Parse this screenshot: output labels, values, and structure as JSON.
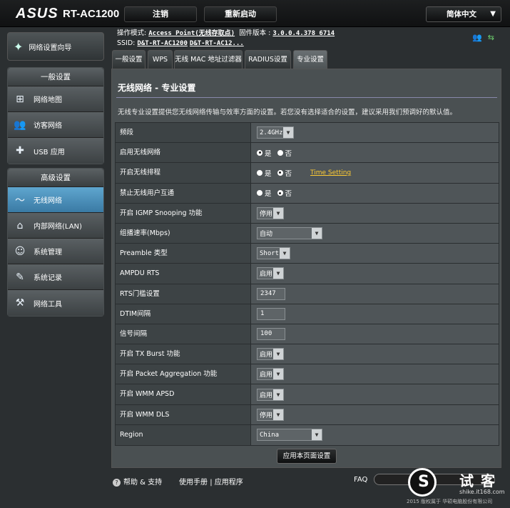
{
  "header": {
    "brand": "ASUS",
    "model": "RT-AC1200",
    "logout_label": "注销",
    "reboot_label": "重新启动",
    "language": "简体中文"
  },
  "info": {
    "mode_label": "操作模式:",
    "mode_value": "Access Point(无线存取点)",
    "firmware_label": "固件版本 :",
    "firmware_value": "3.0.0.4.378_6714",
    "ssid_label": "SSID:",
    "ssid_1": "D&T-RT-AC1200",
    "ssid_2": "D&T-RT-AC12..."
  },
  "sidebar": {
    "wizard_label": "网络设置向导",
    "general_header": "一般设置",
    "general_items": [
      {
        "label": "网络地图",
        "icon": "network-map-icon"
      },
      {
        "label": "访客网络",
        "icon": "guest-network-icon"
      },
      {
        "label": "USB 应用",
        "icon": "usb-app-icon"
      }
    ],
    "advanced_header": "高级设置",
    "advanced_items": [
      {
        "label": "无线网络",
        "icon": "wireless-icon",
        "active": true
      },
      {
        "label": "内部网络(LAN)",
        "icon": "lan-icon"
      },
      {
        "label": "系统管理",
        "icon": "admin-icon"
      },
      {
        "label": "系统记录",
        "icon": "log-icon"
      },
      {
        "label": "网络工具",
        "icon": "tools-icon"
      }
    ]
  },
  "tabs": [
    "一般设置",
    "WPS",
    "无线 MAC 地址过滤器",
    "RADIUS设置",
    "专业设置"
  ],
  "main": {
    "title": "无线网络 - 专业设置",
    "description": "无线专业设置提供您无线网络传输与效率方面的设置。若您没有选择适合的设置，建议采用我们预调好的默认值。",
    "radio_yes": "是",
    "radio_no": "否",
    "time_setting_link": "Time Setting",
    "apply_label": "应用本页面设置",
    "rows": {
      "band": {
        "label": "频段",
        "value": "2.4GHz"
      },
      "enable_radio": {
        "label": "启用无线网络"
      },
      "radio_schedule": {
        "label": "开启无线排程"
      },
      "isolation": {
        "label": "禁止无线用户互通"
      },
      "igmp": {
        "label": "开启 IGMP Snooping 功能",
        "value": "停用"
      },
      "multicast_rate": {
        "label": "组播速率(Mbps)",
        "value": "自动"
      },
      "preamble": {
        "label": "Preamble 类型",
        "value": "Short"
      },
      "ampdu": {
        "label": "AMPDU RTS",
        "value": "启用"
      },
      "rts": {
        "label": "RTS门槛设置",
        "value": "2347"
      },
      "dtim": {
        "label": "DTIM间隔",
        "value": "1"
      },
      "beacon": {
        "label": "信号间隔",
        "value": "100"
      },
      "txburst": {
        "label": "开启 TX Burst 功能",
        "value": "启用"
      },
      "aggregation": {
        "label": "开启 Packet Aggregation 功能",
        "value": "启用"
      },
      "apsd": {
        "label": "开启 WMM APSD",
        "value": "启用"
      },
      "dls": {
        "label": "开启 WMM DLS",
        "value": "停用"
      },
      "region": {
        "label": "Region",
        "value": "China"
      }
    }
  },
  "footer": {
    "help": "帮助 & 支持",
    "manual": "使用手册",
    "sep": "|",
    "app": "应用程序",
    "faq": "FAQ",
    "copyright": "2015 版权属于 华硕电脑股份有限公司"
  },
  "watermark": {
    "cn": "试客",
    "url": "shike.it168.com"
  },
  "colors": {
    "accent": "#5fa6cf",
    "link": "#ffcc33",
    "usb": "#6fd46f"
  }
}
